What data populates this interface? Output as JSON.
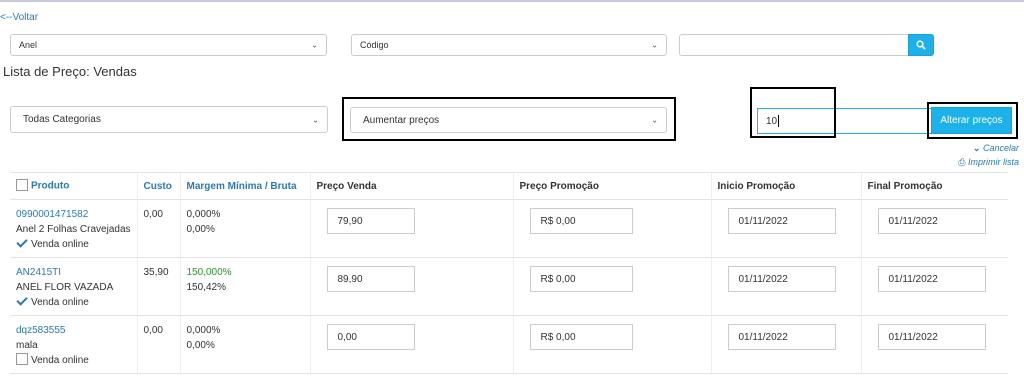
{
  "nav": {
    "back_label": "<--Voltar"
  },
  "filters": {
    "product_select": "Anel",
    "field_select": "Código",
    "search_value": "",
    "search_icon": "search-icon"
  },
  "page_title": "Lista de Preço: Vendas",
  "controls": {
    "category_select": "Todas Categorias",
    "action_select": "Aumentar preços",
    "amount_value": "10",
    "apply_label": "Alterar preços",
    "cancel_label": "Cancelar",
    "print_label": "Imprimir lista"
  },
  "table": {
    "headers": {
      "produto": "Produto",
      "custo": "Custo",
      "margem": "Margem Mínima / Bruta",
      "preco_venda": "Preço Venda",
      "preco_promo": "Preço Promoção",
      "inicio_promo": "Inicio Promoção",
      "final_promo": "Final Promoção"
    },
    "rows": [
      {
        "code": "0990001471582",
        "name": "Anel 2 Folhas Cravejadas",
        "online_label": "Venda online",
        "online": true,
        "custo": "0,00",
        "margem_min": "0,000%",
        "margem_bruta": "0,00%",
        "preco_venda": "79,90",
        "preco_promo": "R$ 0,00",
        "inicio": "01/11/2022",
        "final": "01/11/2022"
      },
      {
        "code": "AN2415TI",
        "name": "ANEL FLOR VAZADA",
        "online_label": "Venda online",
        "online": true,
        "custo": "35,90",
        "margem_min": "150,000%",
        "margem_bruta": "150,42%",
        "preco_venda": "89,90",
        "preco_promo": "R$ 0,00",
        "inicio": "01/11/2022",
        "final": "01/11/2022"
      },
      {
        "code": "dqz583555",
        "name": "mala",
        "online_label": "Venda online",
        "online": false,
        "custo": "0,00",
        "margem_min": "0,000%",
        "margem_bruta": "0,00%",
        "preco_venda": "0,00",
        "preco_promo": "R$ 0,00",
        "inicio": "01/11/2022",
        "final": "01/11/2022"
      }
    ]
  },
  "colors": {
    "accent": "#1cb1e8",
    "link": "#2a7ab8",
    "positive": "#2a9a2a"
  }
}
